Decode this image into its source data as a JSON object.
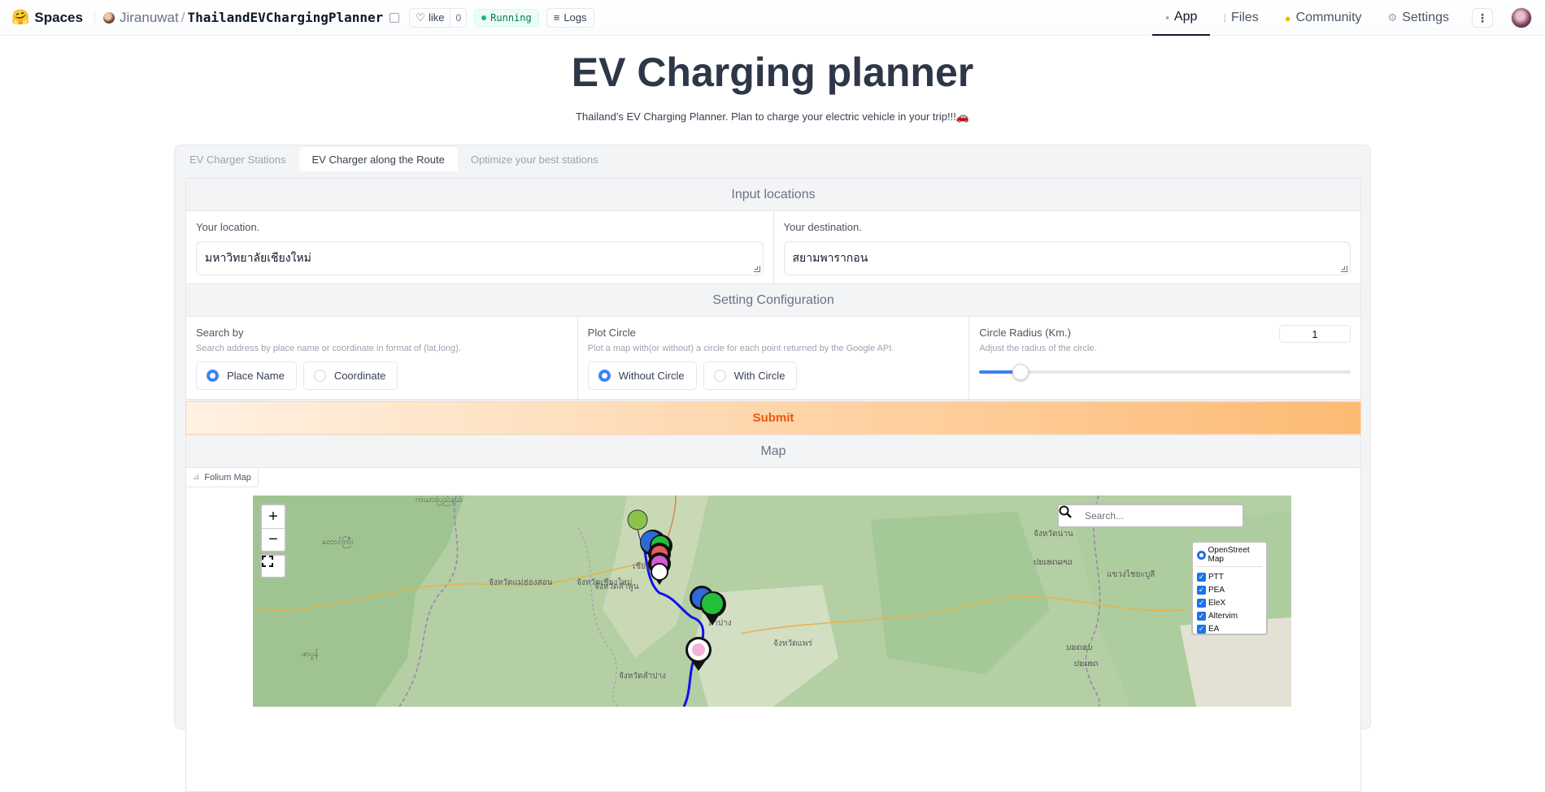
{
  "topbar": {
    "brand": "Spaces",
    "owner": "Jiranuwat",
    "repo": "ThailandEVChargingPlanner",
    "like_label": "like",
    "like_count": "0",
    "status": "Running",
    "logs_label": "Logs",
    "nav": [
      {
        "label": "App",
        "icon": "cube-icon",
        "active": true
      },
      {
        "label": "Files",
        "icon": "files-icon"
      },
      {
        "label": "Community",
        "icon": "community-icon"
      },
      {
        "label": "Settings",
        "icon": "gear-icon"
      }
    ]
  },
  "header": {
    "title": "EV Charging planner",
    "subtitle": "Thailand's EV Charging Planner. Plan to charge your electric vehicle in your trip!!!🚗"
  },
  "tabs": [
    {
      "label": "EV Charger Stations",
      "active": false
    },
    {
      "label": "EV Charger along the Route",
      "active": true
    },
    {
      "label": "Optimize your best stations",
      "active": false
    }
  ],
  "input_locations": {
    "heading": "Input locations",
    "origin_label": "Your location.",
    "origin_value": "มหาวิทยาลัยเชียงใหม่",
    "destination_label": "Your destination.",
    "destination_value": "สยามพารากอน"
  },
  "config": {
    "heading": "Setting Configuration",
    "search_by": {
      "label": "Search by",
      "info": "Search address by place name or coordinate in format of (lat,long).",
      "options": [
        "Place Name",
        "Coordinate"
      ],
      "selected": "Place Name"
    },
    "plot_circle": {
      "label": "Plot Circle",
      "info": "Plot a map with(or without) a circle for each point returned by the Google API.",
      "options": [
        "Without Circle",
        "With Circle"
      ],
      "selected": "Without Circle"
    },
    "radius": {
      "label": "Circle Radius (Km.)",
      "info": "Adjust the radius of the circle.",
      "value": "1",
      "slider_fraction": 0.11
    }
  },
  "submit_label": "Submit",
  "map": {
    "heading": "Map",
    "component_label": "Folium Map",
    "search_placeholder": "Search...",
    "base_layer": "OpenStreet Map",
    "overlays": [
      "PTT",
      "PEA",
      "EleX",
      "Altervim",
      "EA"
    ],
    "zoom_in": "+",
    "zoom_out": "−",
    "place_labels": [
      "ကယားပြည်နယ်",
      "တောင်ကြီး",
      "จังหวัดแม่ฮ่องสอน",
      "จังหวัดเชียงใหม่",
      "เชียงใหม่",
      "จังหวัดลำปาง",
      "จังหวัดลำพูน",
      "จังหวัดแพร่",
      "จังหวัดน่าน",
      "ປະເທດລາວ",
      "แขวงไชยะบูลี",
      "ນະຄອນ",
      "ປະເທດ",
      "ဖာပွန်",
      "ลำปาง"
    ],
    "colors": {
      "route": "#1010ee",
      "marker_blue": "#2a6bd6",
      "marker_green": "#22c03a",
      "marker_black": "#111111"
    }
  }
}
